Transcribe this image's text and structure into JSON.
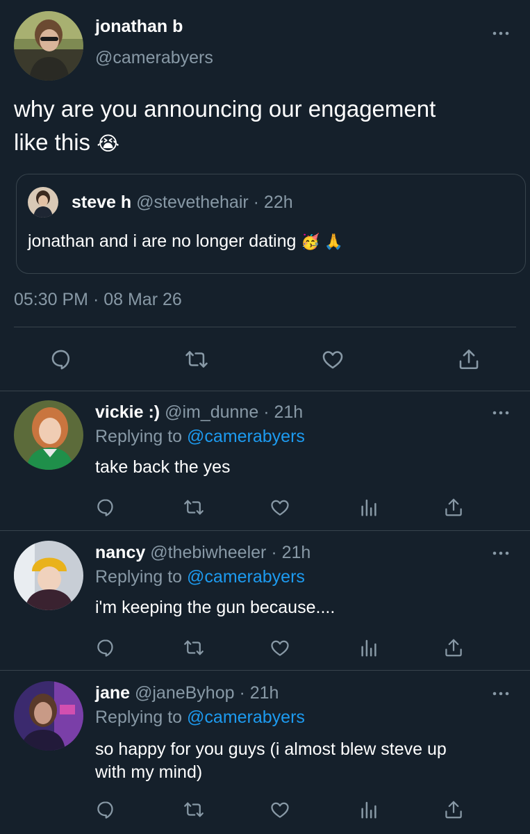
{
  "main_tweet": {
    "display_name": "jonathan b",
    "handle": "@camerabyers",
    "text_line1": "why are you announcing our engagement",
    "text_line2": "like this",
    "emoji": "😭",
    "timestamp": "05:30 PM · 08 Mar 26"
  },
  "quoted_tweet": {
    "display_name": "steve h",
    "handle": "@stevethehair",
    "time": "· 22h",
    "text": "jonathan and i are no longer dating",
    "emojis": "🥳 🙏"
  },
  "replies": [
    {
      "display_name": "vickie :)",
      "handle": "@im_dunne",
      "time": "· 21h",
      "replying_prefix": "Replying to",
      "replying_to": "@camerabyers",
      "text": "take back the yes",
      "text_line2": ""
    },
    {
      "display_name": "nancy",
      "handle": "@thebiwheeler",
      "time": "· 21h",
      "replying_prefix": "Replying to",
      "replying_to": "@camerabyers",
      "text": "i'm keeping the gun because....",
      "text_line2": ""
    },
    {
      "display_name": "jane",
      "handle": "@janeByhop",
      "time": "· 21h",
      "replying_prefix": "Replying to",
      "replying_to": "@camerabyers",
      "text": "so happy for you guys (i almost blew steve up",
      "text_line2": "with my mind)"
    }
  ],
  "icons": [
    "more-icon",
    "reply-icon",
    "retweet-icon",
    "like-icon",
    "analytics-icon",
    "share-icon"
  ],
  "colors": {
    "background": "#15202b",
    "divider": "#38444d",
    "secondary_text": "#8899a6",
    "link": "#1d9bf0",
    "icon": "#8899a6"
  }
}
